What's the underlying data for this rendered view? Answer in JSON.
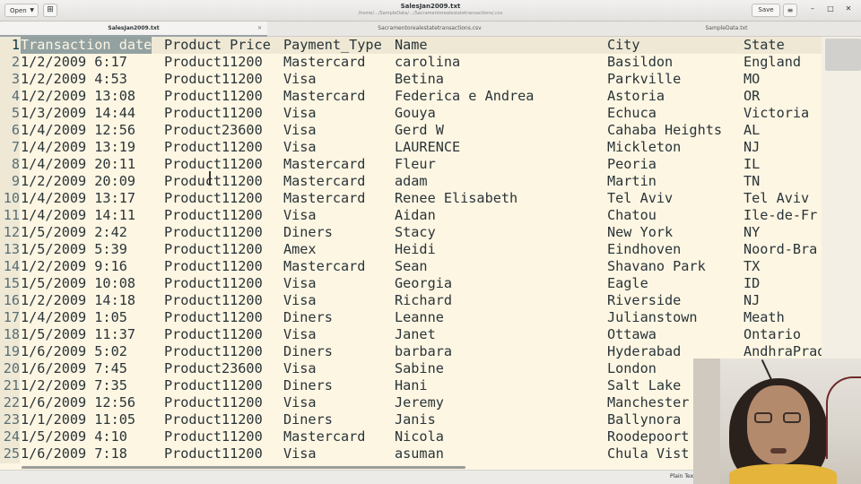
{
  "header": {
    "open_label": "Open",
    "window_title": "SalesJan2009.txt",
    "window_subtitle": "/home/.../SampleData/…/Sacramentorealestatetransactions/.csv",
    "save_label": "Save"
  },
  "tabs": [
    {
      "label": "SalesJan2009.txt",
      "active": true
    },
    {
      "label": "Sacramentorealestatetransactions.csv",
      "active": false
    },
    {
      "label": "SampleData.txt",
      "active": false
    }
  ],
  "editor": {
    "header_row": [
      "Transaction date",
      "Product",
      "Price",
      "Payment_Type",
      "Name",
      "City",
      "State"
    ],
    "rows": [
      {
        "n": "1",
        "date": "Transaction date",
        "prod": "Product Price",
        "pay": "Payment_Type",
        "name": "Name",
        "city": "City",
        "state": "State"
      },
      {
        "n": "2",
        "date": "1/2/2009 6:17",
        "prod": "Product11200",
        "pay": "Mastercard",
        "name": "carolina",
        "city": "Basildon",
        "state": "England"
      },
      {
        "n": "3",
        "date": "1/2/2009 4:53",
        "prod": "Product11200",
        "pay": "Visa",
        "name": "Betina",
        "city": "Parkville",
        "state": "MO"
      },
      {
        "n": "4",
        "date": "1/2/2009 13:08",
        "prod": "Product11200",
        "pay": "Mastercard",
        "name": "Federica e Andrea",
        "city": "Astoria",
        "state": "OR"
      },
      {
        "n": "5",
        "date": "1/3/2009 14:44",
        "prod": "Product11200",
        "pay": "Visa",
        "name": "Gouya",
        "city": "Echuca",
        "state": "Victoria"
      },
      {
        "n": "6",
        "date": "1/4/2009 12:56",
        "prod": "Product23600",
        "pay": "Visa",
        "name": "Gerd W",
        "city": "Cahaba Heights",
        "state": "AL"
      },
      {
        "n": "7",
        "date": "1/4/2009 13:19",
        "prod": "Product11200",
        "pay": "Visa",
        "name": "LAURENCE",
        "city": "Mickleton",
        "state": "NJ"
      },
      {
        "n": "8",
        "date": "1/4/2009 20:11",
        "prod": "Product11200",
        "pay": "Mastercard",
        "name": "Fleur",
        "city": "Peoria",
        "state": "IL"
      },
      {
        "n": "9",
        "date": "1/2/2009 20:09",
        "prod": "Product11200",
        "pay": "Mastercard",
        "name": "adam",
        "city": "Martin",
        "state": "TN"
      },
      {
        "n": "10",
        "date": "1/4/2009 13:17",
        "prod": "Product11200",
        "pay": "Mastercard",
        "name": "Renee Elisabeth",
        "city": "Tel Aviv",
        "state": "Tel Aviv"
      },
      {
        "n": "11",
        "date": "1/4/2009 14:11",
        "prod": "Product11200",
        "pay": "Visa",
        "name": "Aidan",
        "city": "Chatou",
        "state": "Ile-de-Fr"
      },
      {
        "n": "12",
        "date": "1/5/2009 2:42",
        "prod": "Product11200",
        "pay": "Diners",
        "name": "Stacy",
        "city": "New York",
        "state": "NY"
      },
      {
        "n": "13",
        "date": "1/5/2009 5:39",
        "prod": "Product11200",
        "pay": "Amex",
        "name": "Heidi",
        "city": "Eindhoven",
        "state": "Noord-Bra"
      },
      {
        "n": "14",
        "date": "1/2/2009 9:16",
        "prod": "Product11200",
        "pay": "Mastercard",
        "name": "Sean",
        "city": "Shavano Park",
        "state": "TX"
      },
      {
        "n": "15",
        "date": "1/5/2009 10:08",
        "prod": "Product11200",
        "pay": "Visa",
        "name": "Georgia",
        "city": "Eagle",
        "state": "ID"
      },
      {
        "n": "16",
        "date": "1/2/2009 14:18",
        "prod": "Product11200",
        "pay": "Visa",
        "name": "Richard",
        "city": "Riverside",
        "state": "NJ"
      },
      {
        "n": "17",
        "date": "1/4/2009 1:05",
        "prod": "Product11200",
        "pay": "Diners",
        "name": "Leanne",
        "city": "Julianstown",
        "state": "Meath"
      },
      {
        "n": "18",
        "date": "1/5/2009 11:37",
        "prod": "Product11200",
        "pay": "Visa",
        "name": "Janet",
        "city": "Ottawa",
        "state": "Ontario"
      },
      {
        "n": "19",
        "date": "1/6/2009 5:02",
        "prod": "Product11200",
        "pay": "Diners",
        "name": "barbara",
        "city": "Hyderabad",
        "state": "AndhraPradesh"
      },
      {
        "n": "20",
        "date": "1/6/2009 7:45",
        "prod": "Product23600",
        "pay": "Visa",
        "name": "Sabine",
        "city": "London",
        "state": ""
      },
      {
        "n": "21",
        "date": "1/2/2009 7:35",
        "prod": "Product11200",
        "pay": "Diners",
        "name": "Hani",
        "city": "Salt Lake",
        "state": ""
      },
      {
        "n": "22",
        "date": "1/6/2009 12:56",
        "prod": "Product11200",
        "pay": "Visa",
        "name": "Jeremy",
        "city": "Manchester",
        "state": ""
      },
      {
        "n": "23",
        "date": "1/1/2009 11:05",
        "prod": "Product11200",
        "pay": "Diners",
        "name": "Janis",
        "city": "Ballynora",
        "state": ""
      },
      {
        "n": "24",
        "date": "1/5/2009 4:10",
        "prod": "Product11200",
        "pay": "Mastercard",
        "name": "Nicola",
        "city": "Roodepoort",
        "state": ""
      },
      {
        "n": "25",
        "date": "1/6/2009 7:18",
        "prod": "Product11200",
        "pay": "Visa",
        "name": "asuman",
        "city": "Chula Vist",
        "state": ""
      }
    ]
  },
  "status": {
    "language": "Plain Text"
  },
  "colors": {
    "background": "#fdf6e3",
    "gutter": "#eee8d5",
    "selection": "#93a1a1",
    "text": "#2a3438"
  }
}
